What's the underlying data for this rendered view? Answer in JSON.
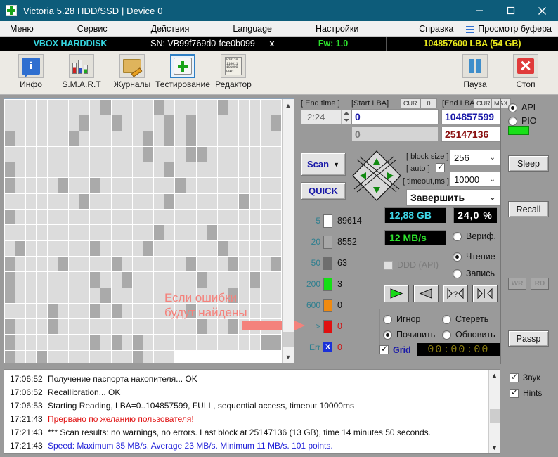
{
  "window": {
    "title": "Victoria 5.28 HDD/SSD | Device 0",
    "minimize": "–",
    "maximize": "□",
    "close": "✕"
  },
  "menu": {
    "items": [
      "Меню",
      "Сервис",
      "Действия",
      "Language",
      "Настройки"
    ],
    "help": "Справка",
    "buffer_view": "Просмотр буфера"
  },
  "device": {
    "model": "VBOX HARDDISK",
    "serial": "SN: VB99f769d0-fce0b099",
    "close_mark": "x",
    "firmware": "Fw: 1.0",
    "capacity": "104857600 LBA (54 GB)"
  },
  "toolbar": {
    "buttons": [
      {
        "label": "Инфо",
        "icon": "info-icon"
      },
      {
        "label": "S.M.A.R.T",
        "icon": "smart-icon"
      },
      {
        "label": "Журналы",
        "icon": "logs-folder-icon"
      },
      {
        "label": "Тестирование",
        "icon": "testing-icon"
      },
      {
        "label": "Редактор",
        "icon": "editor-icon"
      }
    ],
    "editor_icon_text": "010110\n110011\n101000\n0001",
    "pause": {
      "label": "Пауза",
      "icon": "pause-icon"
    },
    "stop": {
      "label": "Стоп",
      "icon": "stop-icon"
    }
  },
  "map": {
    "annotation_line1": "Если ошибки",
    "annotation_line2": "будут найдены",
    "annotation_color": "#f4827c",
    "cell_color": "#dcdcdc",
    "dark_cell_color": "#aaaaaa",
    "columns": 26,
    "rows": 18,
    "dark_cells": [
      9,
      14,
      20,
      33,
      36,
      41,
      43,
      51,
      58,
      52,
      65,
      67,
      69,
      91,
      95,
      96,
      104,
      119,
      130,
      135,
      138,
      146,
      163,
      171,
      178,
      182,
      222,
      227,
      235,
      242,
      247,
      254,
      260,
      265,
      260,
      270,
      277,
      281,
      285,
      286,
      294,
      297,
      304,
      309,
      312,
      321,
      333,
      342,
      346,
      348,
      355,
      364,
      368,
      382,
      385,
      390,
      398,
      400,
      402,
      414,
      415,
      416,
      419,
      428
    ]
  },
  "params": {
    "end_time_label": "[ End time ]",
    "end_time_value": "2:24",
    "start_lba_label": "[Start LBA]",
    "start_lba_cur": "CUR",
    "start_lba_zero": "0",
    "start_lba_value": "0",
    "start_lba_value2": "0",
    "end_lba_label": "[End LBA]",
    "end_lba_cur": "CUR",
    "end_lba_max": "MAX",
    "end_lba_value": "104857599",
    "end_lba_value2": "25147136",
    "scan_button": "Scan",
    "quick_button": "QUICK",
    "block_size_label": "[ block size ]",
    "auto_label": "[ auto ]",
    "auto_checked": true,
    "block_size_value": "256",
    "timeout_label": "[ timeout,ms ]",
    "timeout_value": "10000",
    "finish_action": "Завершить"
  },
  "legend": [
    {
      "threshold": "5",
      "count": "89614",
      "color": "#ffffff"
    },
    {
      "threshold": "20",
      "count": "8552",
      "color": "#a8a8a8"
    },
    {
      "threshold": "50",
      "count": "63",
      "color": "#6e6e6e"
    },
    {
      "threshold": "200",
      "count": "3",
      "color": "#14e014"
    },
    {
      "threshold": "600",
      "count": "0",
      "color": "#f08a10"
    },
    {
      "threshold": ">",
      "count": "0",
      "color": "#e01010"
    },
    {
      "threshold": "Err",
      "count": "0",
      "color": "#1a30d8"
    }
  ],
  "stats": {
    "volume": "12,88 GB",
    "percent": "24,0  %",
    "speed": "12 MB/s",
    "ddd_label": "DDD (API)",
    "ddd_checked": false
  },
  "optype": {
    "verify": "Вериф.",
    "read": "Чтение",
    "write": "Запись",
    "selected": "Чтение"
  },
  "playback": {
    "buttons": [
      "play-forward",
      "play-reverse",
      "seek-unknown",
      "step-end"
    ]
  },
  "defects": {
    "ignore": "Игнор",
    "erase": "Стереть",
    "repair": "Починить",
    "refresh": "Обновить",
    "selected": "Починить"
  },
  "gridrow": {
    "grid_label": "Grid",
    "grid_checked": true,
    "timer": "00:00:00"
  },
  "interface": {
    "api": "API",
    "pio": "PIO",
    "selected": "API",
    "sleep": "Sleep",
    "recall": "Recall",
    "wr": "WR",
    "rd": "RD",
    "passp": "Passp"
  },
  "log": {
    "lines": [
      {
        "time": "17:06:52",
        "text": "Получение паспорта накопителя... OK",
        "color": "black"
      },
      {
        "time": "17:06:52",
        "text": "Recallibration... OK",
        "color": "black"
      },
      {
        "time": "17:06:53",
        "text": "Starting Reading, LBA=0..104857599, FULL, sequential access, timeout 10000ms",
        "color": "black"
      },
      {
        "time": "17:21:43",
        "text": "Прервано по желанию пользователя!",
        "color": "red"
      },
      {
        "time": "17:21:43",
        "text": "*** Scan results: no warnings, no errors. Last block at 25147136 (13 GB), time 14 minutes 50 seconds.",
        "color": "black"
      },
      {
        "time": "17:21:43",
        "text": "Speed: Maximum 35 MB/s. Average 23 MB/s. Minimum 11 MB/s. 101 points.",
        "color": "blue"
      }
    ]
  },
  "options": {
    "sound": "Звук",
    "sound_checked": true,
    "hints": "Hints",
    "hints_checked": true
  }
}
